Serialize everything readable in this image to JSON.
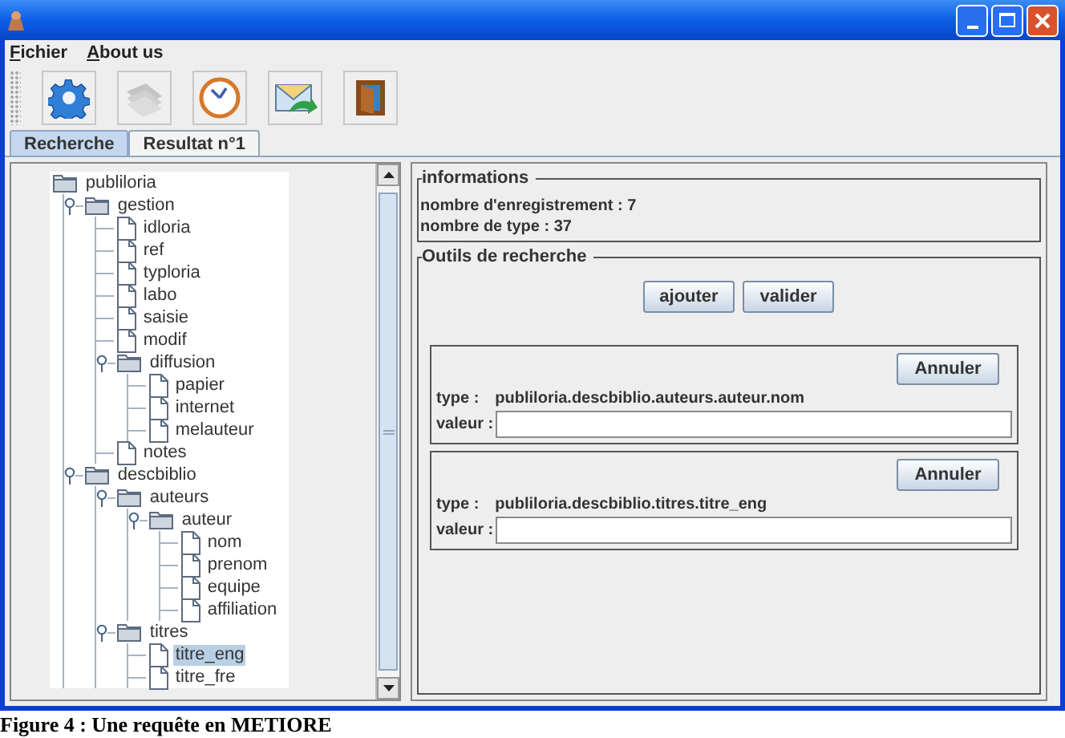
{
  "menu": [
    {
      "label": "Fichier"
    },
    {
      "label": "About us"
    }
  ],
  "toolbar": [
    {
      "kind": "gear",
      "disabled": false
    },
    {
      "kind": "pages",
      "disabled": true
    },
    {
      "kind": "clock",
      "disabled": false
    },
    {
      "kind": "mail",
      "disabled": false
    },
    {
      "kind": "door",
      "disabled": false
    }
  ],
  "tabs": [
    {
      "label": "Recherche",
      "selected": true
    },
    {
      "label": "Resultat n°1",
      "selected": false
    }
  ],
  "tree": {
    "label": "publiloria",
    "kind": "folder",
    "expanded": true,
    "selected": false,
    "children": [
      {
        "label": "gestion",
        "kind": "folder",
        "expanded": true,
        "selected": false,
        "children": [
          {
            "label": "idloria",
            "kind": "file",
            "selected": false
          },
          {
            "label": "ref",
            "kind": "file",
            "selected": false
          },
          {
            "label": "typloria",
            "kind": "file",
            "selected": false
          },
          {
            "label": "labo",
            "kind": "file",
            "selected": false
          },
          {
            "label": "saisie",
            "kind": "file",
            "selected": false
          },
          {
            "label": "modif",
            "kind": "file",
            "selected": false
          },
          {
            "label": "diffusion",
            "kind": "folder",
            "expanded": true,
            "selected": false,
            "children": [
              {
                "label": "papier",
                "kind": "file",
                "selected": false
              },
              {
                "label": "internet",
                "kind": "file",
                "selected": false
              },
              {
                "label": "melauteur",
                "kind": "file",
                "selected": false
              }
            ]
          },
          {
            "label": "notes",
            "kind": "file",
            "selected": false
          }
        ]
      },
      {
        "label": "descbiblio",
        "kind": "folder",
        "expanded": true,
        "selected": false,
        "children": [
          {
            "label": "auteurs",
            "kind": "folder",
            "expanded": true,
            "selected": false,
            "children": [
              {
                "label": "auteur",
                "kind": "folder",
                "expanded": true,
                "selected": false,
                "children": [
                  {
                    "label": "nom",
                    "kind": "file",
                    "selected": false
                  },
                  {
                    "label": "prenom",
                    "kind": "file",
                    "selected": false
                  },
                  {
                    "label": "equipe",
                    "kind": "file",
                    "selected": false
                  },
                  {
                    "label": "affiliation",
                    "kind": "file",
                    "selected": false
                  }
                ]
              }
            ]
          },
          {
            "label": "titres",
            "kind": "folder",
            "expanded": true,
            "selected": false,
            "children": [
              {
                "label": "titre_eng",
                "kind": "file",
                "selected": true
              },
              {
                "label": "titre_fre",
                "kind": "file",
                "selected": false
              }
            ]
          }
        ]
      }
    ]
  },
  "informations": {
    "title": "informations",
    "lines": [
      "nombre d'enregistrement : 7",
      "nombre de type : 37"
    ]
  },
  "search_tools": {
    "title": "Outils de recherche",
    "buttons": [
      "ajouter",
      "valider"
    ],
    "criteria": [
      {
        "cancel": "Annuler",
        "type_label": "type :",
        "type_value": "publiloria.descbiblio.auteurs.auteur.nom",
        "value_label": "valeur :"
      },
      {
        "cancel": "Annuler",
        "type_label": "type :",
        "type_value": "publiloria.descbiblio.titres.titre_eng",
        "value_label": "valeur :"
      }
    ]
  },
  "caption": "Figure 4 : Une requête en METIORE"
}
